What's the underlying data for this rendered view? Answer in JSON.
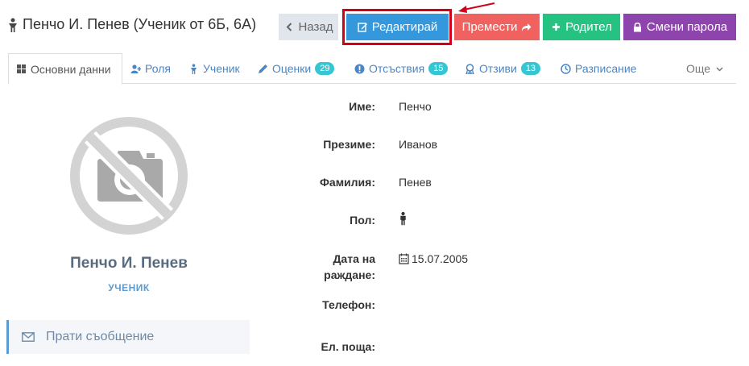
{
  "header": {
    "title": "Пенчо И. Пенев (Ученик от 6Б, 6А)"
  },
  "toolbar": {
    "back_label": "Назад",
    "edit_label": "Редактирай",
    "move_label": "Премести",
    "parent_label": "Родител",
    "password_label": "Смени парола"
  },
  "tabs": [
    {
      "label": "Основни данни",
      "icon": "grid-icon"
    },
    {
      "label": "Роля",
      "icon": "user-plus-icon"
    },
    {
      "label": "Ученик",
      "icon": "student-icon"
    },
    {
      "label": "Оценки",
      "icon": "pencil-icon",
      "badge": "29"
    },
    {
      "label": "Отсъствия",
      "icon": "exclamation-icon",
      "badge": "15"
    },
    {
      "label": "Отзиви",
      "icon": "award-icon",
      "badge": "13"
    },
    {
      "label": "Разписание",
      "icon": "clock-icon"
    },
    {
      "label": "Още",
      "icon": "chevron-down-icon"
    }
  ],
  "profile": {
    "name": "Пенчо И. Пенев",
    "role": "УЧЕНИК",
    "send_message_label": "Прати съобщение"
  },
  "details": {
    "first_name_label": "Име:",
    "first_name": "Пенчо",
    "middle_name_label": "Презиме:",
    "middle_name": "Иванов",
    "last_name_label": "Фамилия:",
    "last_name": "Пенев",
    "gender_label": "Пол:",
    "gender_icon": "male-icon",
    "birthdate_label_line1": "Дата на",
    "birthdate_label_line2": "раждане:",
    "birthdate": "15.07.2005",
    "phone_label": "Телефон:",
    "email_label": "Ел. поща:"
  },
  "colors": {
    "edit": "#3598dc",
    "move": "#f0625f",
    "parent": "#26c281",
    "password": "#8e44ad",
    "highlight": "#d0021b",
    "badge": "#36c6d3"
  }
}
